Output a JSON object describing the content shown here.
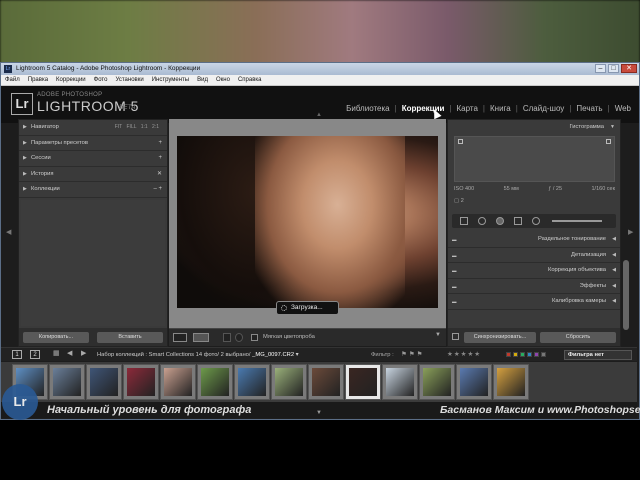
{
  "window": {
    "title": "Lightroom 5 Catalog - Adobe Photoshop Lightroom - Коррекции",
    "buttons": {
      "minimize": "–",
      "maximize": "□",
      "close": "✕"
    },
    "app_icon": "Lr"
  },
  "menu": [
    "Файл",
    "Правка",
    "Коррекции",
    "Фото",
    "Установки",
    "Инструменты",
    "Вид",
    "Окно",
    "Справка"
  ],
  "identity": {
    "logo": "Lr",
    "small": "ADOBE PHOTOSHOP",
    "name": "LIGHTROOM 5",
    "beta": "BETA"
  },
  "modules": [
    {
      "label": "Библиотека",
      "active": false
    },
    {
      "label": "Коррекции",
      "active": true
    },
    {
      "label": "Карта",
      "active": false
    },
    {
      "label": "Книга",
      "active": false
    },
    {
      "label": "Слайд-шоу",
      "active": false
    },
    {
      "label": "Печать",
      "active": false
    },
    {
      "label": "Web",
      "active": false
    }
  ],
  "left_panel": {
    "navigator": {
      "label": "Навигатор",
      "options": "FIT  FILL  1:1  2:1"
    },
    "items": [
      {
        "label": "Параметры пресетов",
        "action": "+"
      },
      {
        "label": "Сессии",
        "action": "+"
      },
      {
        "label": "История",
        "action": "✕"
      },
      {
        "label": "Коллекции",
        "action": "– +"
      }
    ],
    "copy_button": "Копировать...",
    "paste_button": "Вставить"
  },
  "center": {
    "loading_text": "Загрузка...",
    "toolbar_label": "Мягкая цветопроба"
  },
  "right_panel": {
    "histogram_title": "Гистограмма",
    "exif": {
      "iso": "ISO 400",
      "focal": "55 мм",
      "aperture": "ƒ / 25",
      "shutter": "1/160 сек"
    },
    "exif_count": "2",
    "sections": [
      "Раздельное тонирование",
      "Детализация",
      "Коррекция объектива",
      "Эффекты",
      "Калибровка камеры"
    ],
    "sync_button": "Синхронизировать...",
    "reset_button": "Сбросить"
  },
  "filmbar": {
    "page1": "1",
    "page2": "2",
    "source_text": "Набор коллекций : Smart Collections  14 фото/  2 выбрано/",
    "filename": "_MG_0097.CR2",
    "filter_label": "Фильтр :",
    "stars": "★★★★★",
    "flags": "⚑⚑⚑",
    "filter_dropdown": "Фильтра нет",
    "color_labels": [
      "#c0392b",
      "#d4ac0d",
      "#27ae60",
      "#2e86c1",
      "#8e44ad",
      "#777777"
    ]
  },
  "filmstrip": {
    "thumbs": [
      "#5e8fc4",
      "#6a7f9a",
      "#3f5577",
      "#8c2a3a",
      "#c9a090",
      "#6d9a4a",
      "#4a7ab0",
      "#9ab07a",
      "#6b4a3a",
      "#3a2622",
      "#c8d4e0",
      "#8aa05a",
      "#5a7ab0",
      "#d4a040"
    ]
  },
  "captions": {
    "watermark_logo": "Lr",
    "left": "Начальный уровень для фотографа",
    "right": "Басманов Максим и www.Photoshopsecrets.ru"
  }
}
